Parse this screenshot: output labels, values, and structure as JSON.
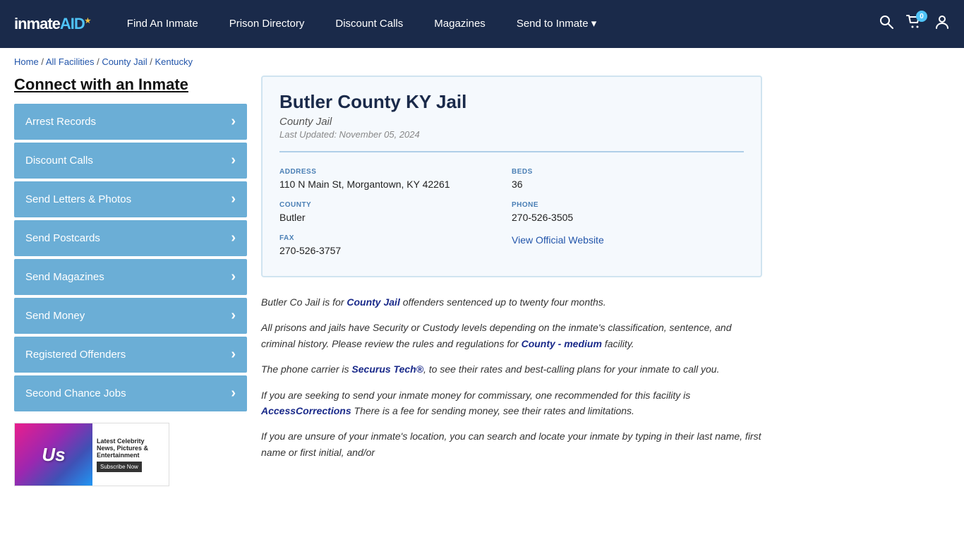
{
  "nav": {
    "logo": "inmateAID",
    "logo_star": "★",
    "links": [
      {
        "label": "Find An Inmate",
        "id": "find-inmate"
      },
      {
        "label": "Prison Directory",
        "id": "prison-directory"
      },
      {
        "label": "Discount Calls",
        "id": "discount-calls"
      },
      {
        "label": "Magazines",
        "id": "magazines"
      },
      {
        "label": "Send to Inmate ▾",
        "id": "send-to-inmate"
      }
    ],
    "cart_count": "0",
    "search_icon": "🔍",
    "cart_icon": "🛒",
    "user_icon": "👤"
  },
  "breadcrumb": {
    "home": "Home",
    "all_facilities": "All Facilities",
    "county_jail": "County Jail",
    "state": "Kentucky"
  },
  "sidebar": {
    "title": "Connect with an Inmate",
    "items": [
      {
        "label": "Arrest Records"
      },
      {
        "label": "Discount Calls"
      },
      {
        "label": "Send Letters & Photos"
      },
      {
        "label": "Send Postcards"
      },
      {
        "label": "Send Magazines"
      },
      {
        "label": "Send Money"
      },
      {
        "label": "Registered Offenders"
      },
      {
        "label": "Second Chance Jobs"
      }
    ],
    "ad": {
      "brand": "Us",
      "title": "Latest Celebrity News, Pictures & Entertainment",
      "subtitle": "",
      "button": "Subscribe Now"
    }
  },
  "facility": {
    "name": "Butler County KY Jail",
    "type": "County Jail",
    "last_updated": "Last Updated: November 05, 2024",
    "address_label": "ADDRESS",
    "address": "110 N Main St, Morgantown, KY 42261",
    "beds_label": "BEDS",
    "beds": "36",
    "county_label": "COUNTY",
    "county": "Butler",
    "phone_label": "PHONE",
    "phone": "270-526-3505",
    "fax_label": "FAX",
    "fax": "270-526-3757",
    "website_label": "View Official Website",
    "website_url": "#"
  },
  "description": {
    "para1_pre": "Butler Co Jail is for ",
    "para1_link": "County Jail",
    "para1_post": " offenders sentenced up to twenty four months.",
    "para2_pre": "All prisons and jails have Security or Custody levels depending on the inmate's classification, sentence, and criminal history. Please review the rules and regulations for ",
    "para2_link": "County - medium",
    "para2_post": " facility.",
    "para3_pre": "The phone carrier is ",
    "para3_link": "Securus Tech®",
    "para3_post": ", to see their rates and best-calling plans for your inmate to call you.",
    "para4_pre": "If you are seeking to send your inmate money for commissary, one recommended for this facility is ",
    "para4_link": "AccessCorrections",
    "para4_post": " There is a fee for sending money, see their rates and limitations.",
    "para5": "If you are unsure of your inmate's location, you can search and locate your inmate by typing in their last name, first name or first initial, and/or"
  }
}
